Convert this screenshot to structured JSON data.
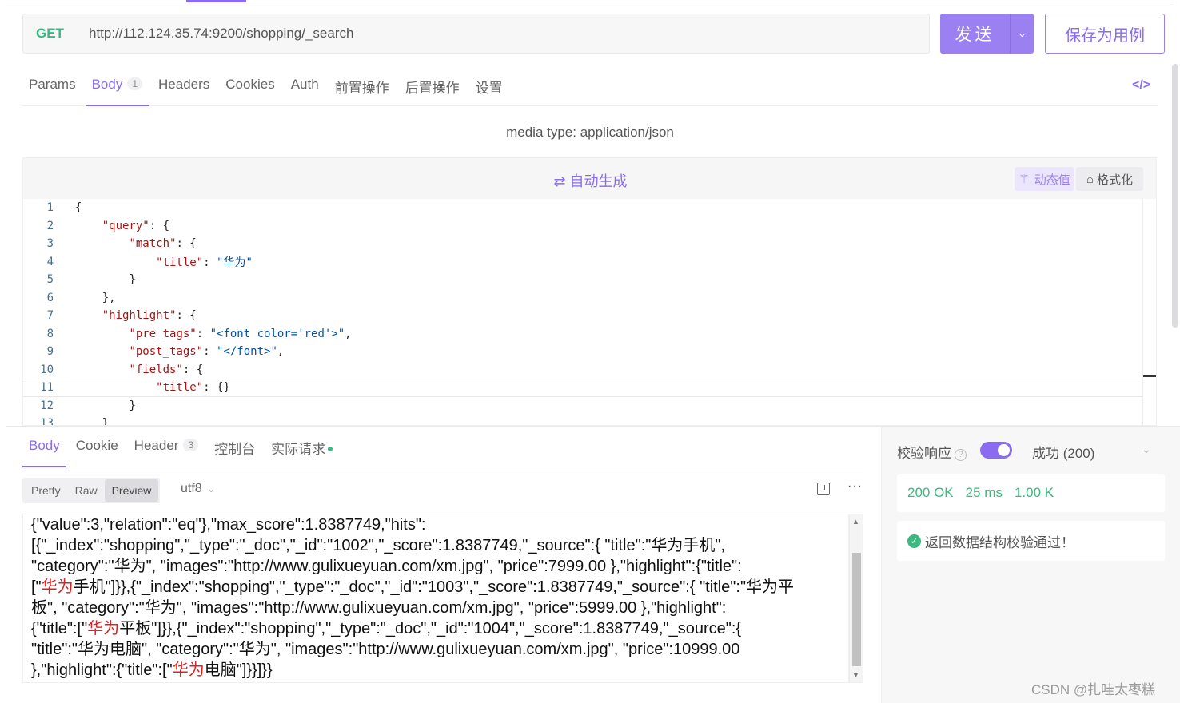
{
  "request": {
    "method": "GET",
    "url": "http://112.124.35.74:9200/shopping/_search",
    "send_label": "发送",
    "save_label": "保存为用例"
  },
  "request_tabs": [
    {
      "label": "Params"
    },
    {
      "label": "Body",
      "badge": "1",
      "active": true
    },
    {
      "label": "Headers"
    },
    {
      "label": "Cookies"
    },
    {
      "label": "Auth"
    },
    {
      "label": "前置操作"
    },
    {
      "label": "后置操作"
    },
    {
      "label": "设置"
    }
  ],
  "code_icon": "</>",
  "media_type": "media type: application/json",
  "editor": {
    "autogen_label": "⇄ 自动生成",
    "dynamic_label": "动态值",
    "format_label": "格式化",
    "current_line": 11,
    "lines": [
      {
        "n": "1",
        "indent": 0,
        "tokens": [
          {
            "t": "{",
            "c": ""
          }
        ]
      },
      {
        "n": "2",
        "indent": 1,
        "tokens": [
          {
            "t": "\"query\"",
            "c": "k"
          },
          {
            "t": ": {",
            "c": ""
          }
        ]
      },
      {
        "n": "3",
        "indent": 2,
        "tokens": [
          {
            "t": "\"match\"",
            "c": "k"
          },
          {
            "t": ": {",
            "c": ""
          }
        ]
      },
      {
        "n": "4",
        "indent": 3,
        "tokens": [
          {
            "t": "\"title\"",
            "c": "k"
          },
          {
            "t": ": ",
            "c": ""
          },
          {
            "t": "\"华为\"",
            "c": "s"
          }
        ]
      },
      {
        "n": "5",
        "indent": 2,
        "tokens": [
          {
            "t": "}",
            "c": ""
          }
        ]
      },
      {
        "n": "6",
        "indent": 1,
        "tokens": [
          {
            "t": "},",
            "c": ""
          }
        ]
      },
      {
        "n": "7",
        "indent": 1,
        "tokens": [
          {
            "t": "\"highlight\"",
            "c": "k"
          },
          {
            "t": ": {",
            "c": ""
          }
        ]
      },
      {
        "n": "8",
        "indent": 2,
        "tokens": [
          {
            "t": "\"pre_tags\"",
            "c": "k"
          },
          {
            "t": ": ",
            "c": ""
          },
          {
            "t": "\"<font color='red'>\"",
            "c": "s"
          },
          {
            "t": ",",
            "c": ""
          }
        ]
      },
      {
        "n": "9",
        "indent": 2,
        "tokens": [
          {
            "t": "\"post_tags\"",
            "c": "k"
          },
          {
            "t": ": ",
            "c": ""
          },
          {
            "t": "\"</font>\"",
            "c": "s"
          },
          {
            "t": ",",
            "c": ""
          }
        ]
      },
      {
        "n": "10",
        "indent": 2,
        "tokens": [
          {
            "t": "\"fields\"",
            "c": "k"
          },
          {
            "t": ": {",
            "c": ""
          }
        ]
      },
      {
        "n": "11",
        "indent": 3,
        "tokens": [
          {
            "t": "\"title\"",
            "c": "k"
          },
          {
            "t": ": {}",
            "c": ""
          }
        ]
      },
      {
        "n": "12",
        "indent": 2,
        "tokens": [
          {
            "t": "}",
            "c": ""
          }
        ]
      },
      {
        "n": "13",
        "indent": 1,
        "tokens": [
          {
            "t": "}",
            "c": ""
          }
        ]
      }
    ]
  },
  "response_tabs": [
    {
      "label": "Body",
      "active": true
    },
    {
      "label": "Cookie"
    },
    {
      "label": "Header",
      "badge": "3"
    },
    {
      "label": "控制台"
    },
    {
      "label": "实际请求",
      "dot": true
    }
  ],
  "view_modes": [
    {
      "label": "Pretty"
    },
    {
      "label": "Raw"
    },
    {
      "label": "Preview",
      "active": true
    }
  ],
  "encoding": "utf8",
  "more_label": "···",
  "response_lines": [
    [
      {
        "t": "{\"value\":3,\"relation\":\"eq\"},\"max_score\":1.8387749,\"hits\":"
      }
    ],
    [
      {
        "t": "[{\"_index\":\"shopping\",\"_type\":\"_doc\",\"_id\":\"1002\",\"_score\":1.8387749,\"_source\":{ \"title\":\"华为手机\","
      }
    ],
    [
      {
        "t": "\"category\":\"华为\", \"images\":\"http://www.gulixueyuan.com/xm.jpg\", \"price\":7999.00 },\"highlight\":{\"title\":"
      }
    ],
    [
      {
        "t": "[\""
      },
      {
        "t": "华为",
        "hl": true
      },
      {
        "t": "手机\"]}},{\"_index\":\"shopping\",\"_type\":\"_doc\",\"_id\":\"1003\",\"_score\":1.8387749,\"_source\":{ \"title\":\"华为平"
      }
    ],
    [
      {
        "t": "板\", \"category\":\"华为\", \"images\":\"http://www.gulixueyuan.com/xm.jpg\", \"price\":5999.00 },\"highlight\":"
      }
    ],
    [
      {
        "t": "{\"title\":[\""
      },
      {
        "t": "华为",
        "hl": true
      },
      {
        "t": "平板\"]}},{\"_index\":\"shopping\",\"_type\":\"_doc\",\"_id\":\"1004\",\"_score\":1.8387749,\"_source\":{"
      }
    ],
    [
      {
        "t": "\"title\":\"华为电脑\", \"category\":\"华为\", \"images\":\"http://www.gulixueyuan.com/xm.jpg\", \"price\":10999.00"
      }
    ],
    [
      {
        "t": "},\"highlight\":{\"title\":[\""
      },
      {
        "t": "华为",
        "hl": true
      },
      {
        "t": "电脑\"]}}]}}"
      }
    ]
  ],
  "validation": {
    "label": "校验响应",
    "help_icon": "?",
    "enabled": true,
    "selected": "成功 (200)",
    "status": "200 OK",
    "time": "25 ms",
    "size": "1.00 K",
    "message": "返回数据结构校验通过！"
  },
  "watermark": "CSDN @扎哇太枣糕",
  "colors": {
    "accent": "#8b6cf0",
    "success": "#39b97f",
    "highlight": "#e02020"
  }
}
